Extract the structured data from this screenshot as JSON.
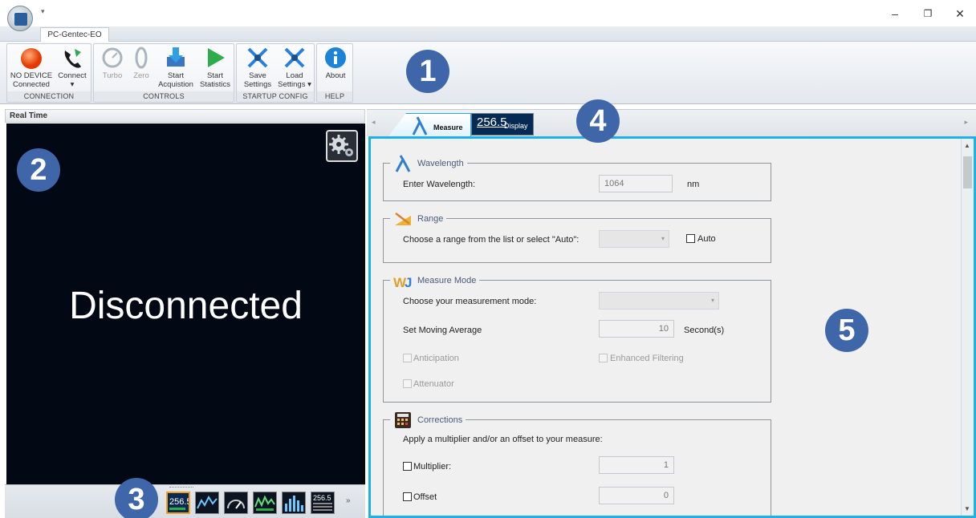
{
  "titlebar": {
    "window_controls": {
      "minimize": "–",
      "restore": "❐",
      "close": "✕"
    }
  },
  "ribbon": {
    "tab_label": "PC-Gentec-EO",
    "groups": [
      {
        "label": "CONNECTION",
        "buttons": [
          {
            "label_line1": "NO DEVICE",
            "label_line2": "Connected",
            "icon": "red-status-icon"
          },
          {
            "label_line1": "Connect",
            "label_line2": "▾",
            "icon": "phone-connect-icon"
          }
        ]
      },
      {
        "label": "CONTROLS",
        "buttons": [
          {
            "label_line1": "Turbo",
            "label_line2": "",
            "icon": "turbo-icon"
          },
          {
            "label_line1": "Zero",
            "label_line2": "",
            "icon": "zero-icon"
          },
          {
            "label_line1": "Start",
            "label_line2": "Acquistion",
            "icon": "download-icon"
          },
          {
            "label_line1": "Start",
            "label_line2": "Statistics",
            "icon": "play-icon"
          }
        ]
      },
      {
        "label": "STARTUP CONFIG",
        "buttons": [
          {
            "label_line1": "Save",
            "label_line2": "Settings",
            "icon": "save-settings-icon"
          },
          {
            "label_line1": "Load",
            "label_line2": "Settings ▾",
            "icon": "load-settings-icon"
          }
        ]
      },
      {
        "label": "HELP",
        "buttons": [
          {
            "label_line1": "About",
            "label_line2": "",
            "icon": "info-icon"
          }
        ]
      }
    ]
  },
  "left_pane": {
    "header": "Real Time",
    "status_text": "Disconnected"
  },
  "badges": [
    "1",
    "2",
    "3",
    "4",
    "5"
  ],
  "right_tabs": [
    {
      "label": "Measure",
      "icon": "lambda-icon"
    },
    {
      "number": "256.5",
      "label": "Display"
    }
  ],
  "wavelength": {
    "title": "Wavelength",
    "prompt": "Enter Wavelength:",
    "value": "1064",
    "unit": "nm"
  },
  "range": {
    "title": "Range",
    "prompt": "Choose a range from the list or select \"Auto\":",
    "auto_label": "Auto"
  },
  "measure_mode": {
    "title": "Measure Mode",
    "prompt": "Choose your measurement mode:",
    "moving_avg_label": "Set Moving Average",
    "moving_avg_value": "10",
    "moving_avg_unit": "Second(s)",
    "anticipation": "Anticipation",
    "enhanced_filtering": "Enhanced Filtering",
    "attenuator": "Attenuator"
  },
  "corrections": {
    "title": "Corrections",
    "prompt": "Apply a multiplier and/or an offset to your measure:",
    "multiplier_label": "Multiplier:",
    "multiplier_value": "1",
    "offset_label": "Offset",
    "offset_value": "0"
  },
  "colors": {
    "accent_blue": "#1fb0e8",
    "badge_blue": "#3e66a8",
    "display_black": "#020814"
  }
}
